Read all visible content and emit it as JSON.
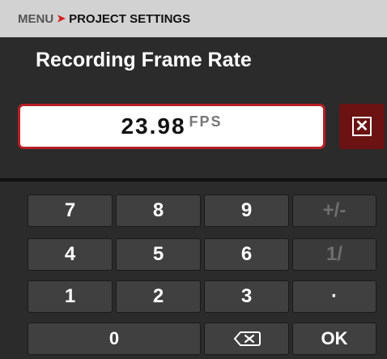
{
  "breadcrumb": {
    "menu": "MENU",
    "separator": "➤",
    "current": "PROJECT SETTINGS"
  },
  "title": "Recording Frame Rate",
  "value": {
    "number": "23.98",
    "unit": "FPS"
  },
  "clear_button": {
    "icon": "clear-box-icon",
    "glyph": "✕"
  },
  "keypad": {
    "row1": [
      "7",
      "8",
      "9",
      "+/-"
    ],
    "row2": [
      "4",
      "5",
      "6",
      "1/"
    ],
    "row3": [
      "1",
      "2",
      "3",
      "·"
    ],
    "row4": {
      "zero": "0",
      "backspace_icon": "backspace-icon",
      "ok": "OK"
    }
  },
  "colors": {
    "accent": "#b51f24",
    "clear_bg": "#6b1212",
    "header_bg": "#d2d2d2"
  }
}
